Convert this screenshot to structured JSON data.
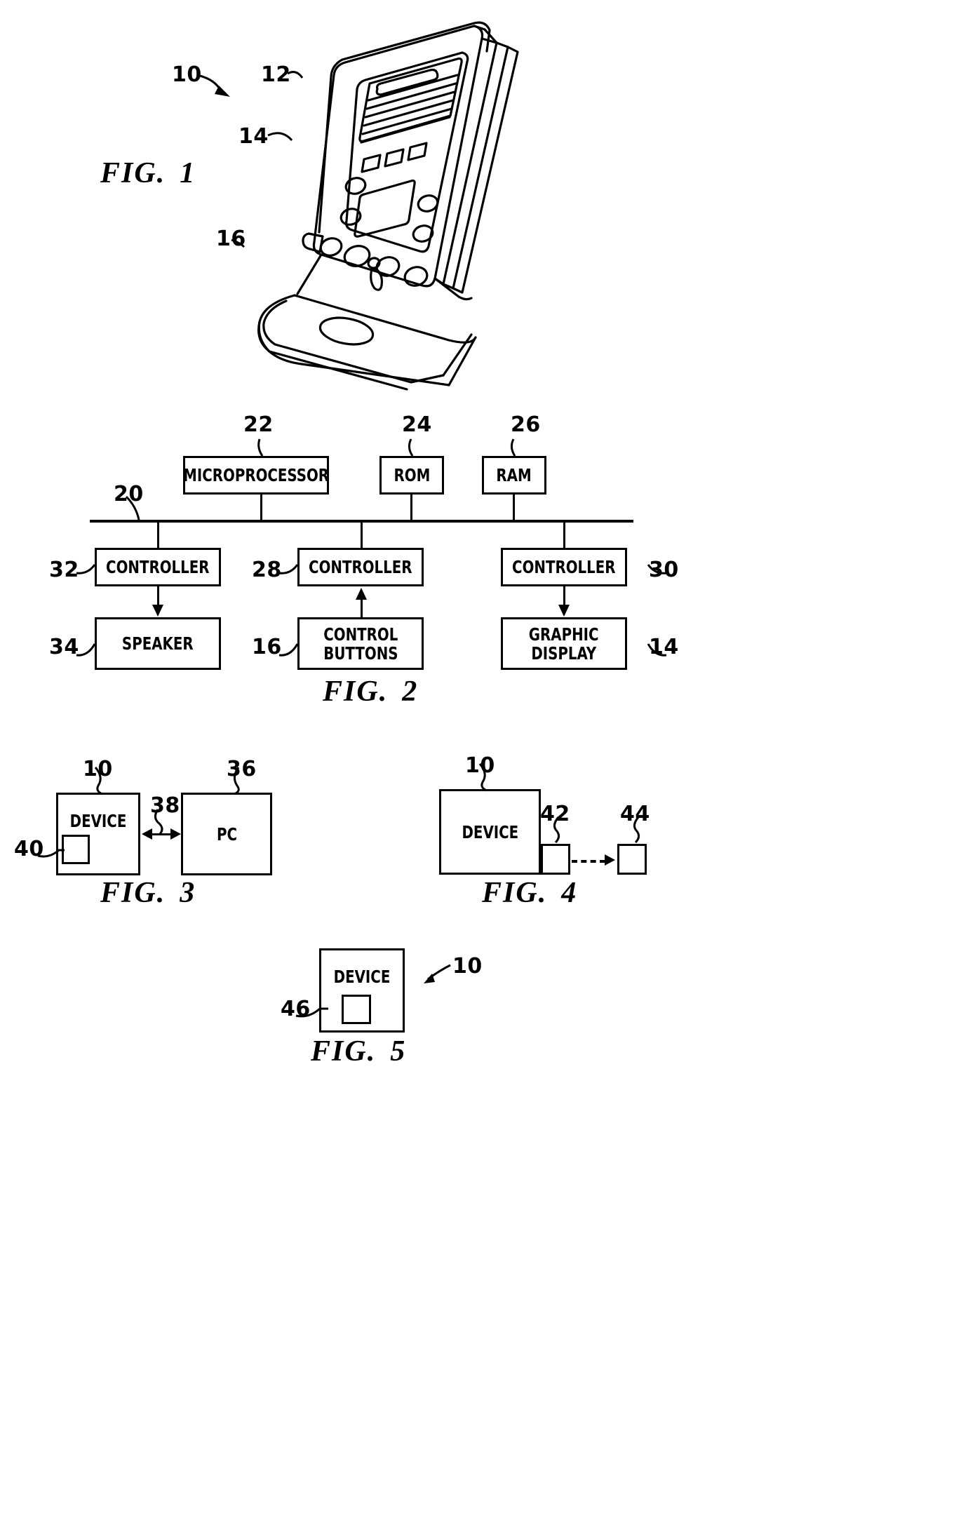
{
  "document": {
    "type": "patent-drawing-sheet",
    "background_color": "#ffffff",
    "ink_color": "#000000"
  },
  "figures": [
    {
      "id": "fig1",
      "caption_prefix": "FIG.",
      "caption_number": "1",
      "title": "Perspective view of handheld device on stand",
      "callouts": [
        {
          "ref": "10",
          "target": "device-overall"
        },
        {
          "ref": "12",
          "target": "housing-bezel"
        },
        {
          "ref": "14",
          "target": "graphic-display"
        },
        {
          "ref": "16",
          "target": "control-buttons"
        }
      ]
    },
    {
      "id": "fig2",
      "caption_prefix": "FIG.",
      "caption_number": "2",
      "title": "Block diagram of device electronics",
      "bus": {
        "ref": "20",
        "label": ""
      },
      "blocks": [
        {
          "ref": "22",
          "label": "MICROPROCESSOR"
        },
        {
          "ref": "24",
          "label": "ROM"
        },
        {
          "ref": "26",
          "label": "RAM"
        },
        {
          "ref": "32",
          "label": "CONTROLLER"
        },
        {
          "ref": "28",
          "label": "CONTROLLER"
        },
        {
          "ref": "30",
          "label": "CONTROLLER"
        },
        {
          "ref": "34",
          "label": "SPEAKER"
        },
        {
          "ref": "16",
          "label": "CONTROL\nBUTTONS",
          "line1": "CONTROL",
          "line2": "BUTTONS"
        },
        {
          "ref": "14",
          "label": "GRAPHIC\nDISPLAY",
          "line1": "GRAPHIC",
          "line2": "DISPLAY"
        }
      ]
    },
    {
      "id": "fig3",
      "caption_prefix": "FIG.",
      "caption_number": "3",
      "title": "Device connected to PC",
      "blocks": [
        {
          "ref": "10",
          "label": "DEVICE"
        },
        {
          "ref": "36",
          "label": "PC"
        },
        {
          "ref": "40",
          "label": ""
        }
      ],
      "link": {
        "ref": "38",
        "style": "bidirectional-solid"
      }
    },
    {
      "id": "fig4",
      "caption_prefix": "FIG.",
      "caption_number": "4",
      "title": "Device with wireless transmitter to remote receiver",
      "blocks": [
        {
          "ref": "10",
          "label": "DEVICE"
        },
        {
          "ref": "42",
          "label": ""
        },
        {
          "ref": "44",
          "label": ""
        }
      ],
      "link": {
        "ref": "",
        "style": "unidirectional-dashed"
      }
    },
    {
      "id": "fig5",
      "caption_prefix": "FIG.",
      "caption_number": "5",
      "title": "Device with internal module",
      "blocks": [
        {
          "ref": "10",
          "label": "DEVICE"
        },
        {
          "ref": "46",
          "label": ""
        }
      ]
    }
  ],
  "fig2_labels": {
    "microprocessor": "MICROPROCESSOR",
    "rom": "ROM",
    "ram": "RAM",
    "controller_left": "CONTROLLER",
    "controller_mid": "CONTROLLER",
    "controller_right": "CONTROLLER",
    "speaker": "SPEAKER",
    "control_buttons_l1": "CONTROL",
    "control_buttons_l2": "BUTTONS",
    "graphic_display_l1": "GRAPHIC",
    "graphic_display_l2": "DISPLAY"
  },
  "fig2_refs": {
    "bus": "20",
    "micro": "22",
    "rom": "24",
    "ram": "26",
    "ctrl_left": "32",
    "ctrl_mid": "28",
    "ctrl_right": "30",
    "speaker": "34",
    "buttons": "16",
    "display": "14"
  },
  "fig1_refs": {
    "device": "10",
    "bezel": "12",
    "display": "14",
    "buttons": "16"
  },
  "fig3": {
    "device": "DEVICE",
    "pc": "PC",
    "ref_device": "10",
    "ref_pc": "36",
    "ref_link": "38",
    "ref_port": "40"
  },
  "fig4": {
    "device": "DEVICE",
    "ref_device": "10",
    "ref_transmitter": "42",
    "ref_receiver": "44"
  },
  "fig5": {
    "device": "DEVICE",
    "ref_device": "10",
    "ref_module": "46"
  },
  "captions": {
    "fig1_prefix": "FIG.",
    "fig1_num": "1",
    "fig2_prefix": "FIG.",
    "fig2_num": "2",
    "fig3_prefix": "FIG.",
    "fig3_num": "3",
    "fig4_prefix": "FIG.",
    "fig4_num": "4",
    "fig5_prefix": "FIG.",
    "fig5_num": "5"
  }
}
